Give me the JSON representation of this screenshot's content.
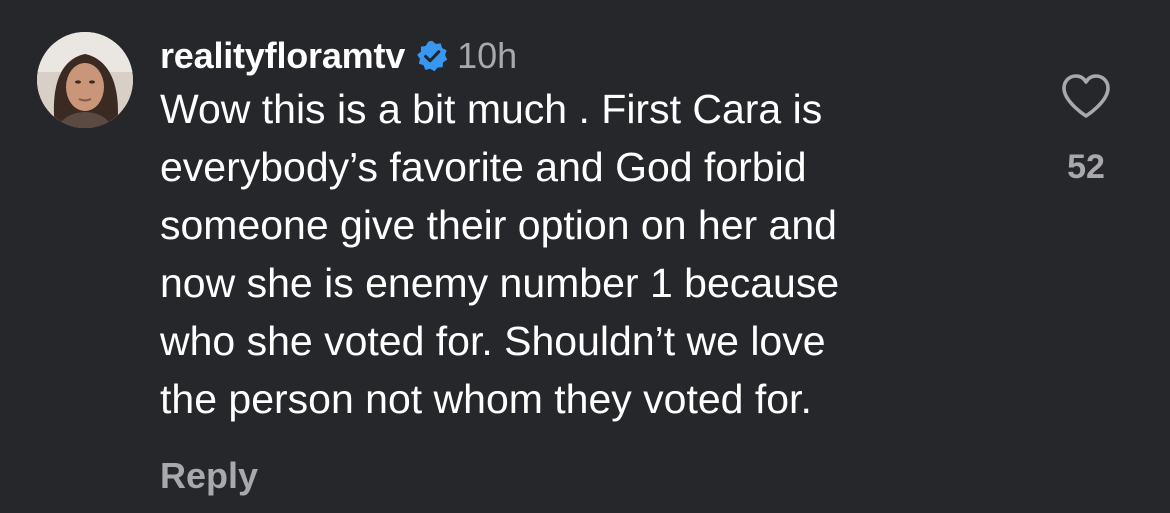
{
  "comment": {
    "username": "realityfloramtv",
    "verified": true,
    "time": "10h",
    "text_lines": [
      "Wow this is a bit much . First Cara is",
      "everybody’s favorite and God forbid",
      "someone give their option on her and",
      "now she is enemy number 1 because",
      "who she voted for. Shouldn’t we love",
      "the person not whom they voted for."
    ],
    "reply_label": "Reply",
    "like_icon": "heart-outline-icon",
    "like_count": "52"
  },
  "colors": {
    "background": "#26272b",
    "primary_text": "#ffffff",
    "secondary_text": "#a8a8ad",
    "verified_badge": "#3897f0"
  }
}
